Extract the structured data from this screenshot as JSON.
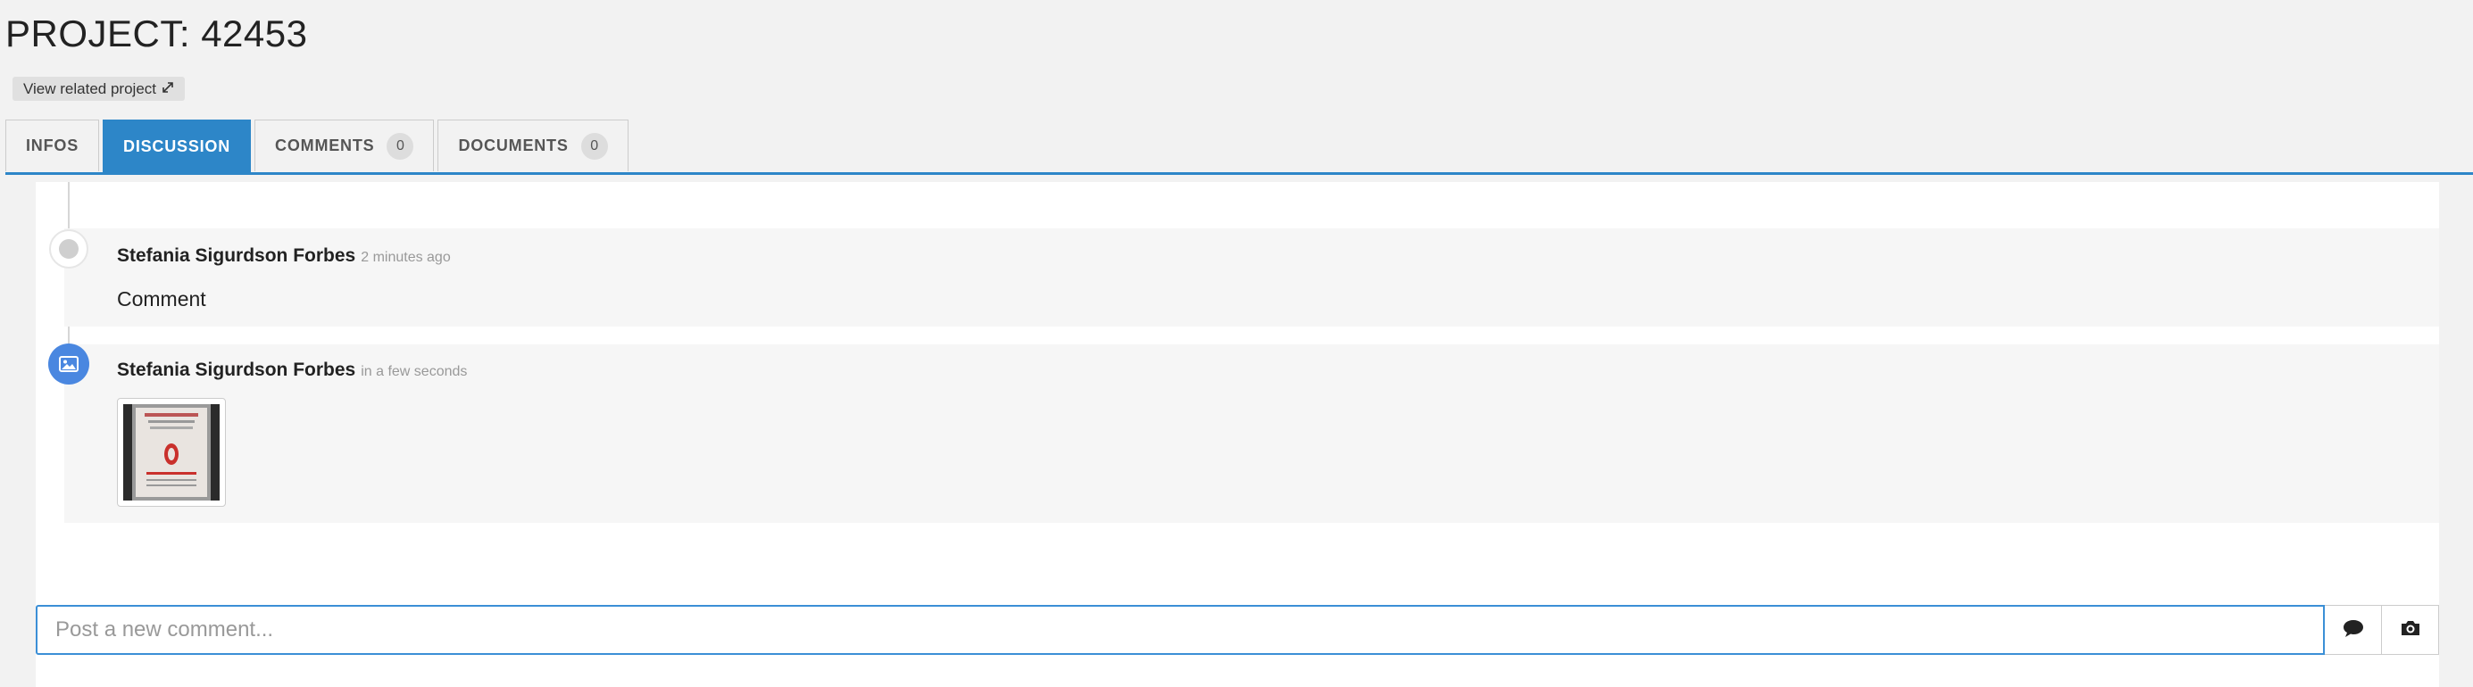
{
  "page": {
    "title": "PROJECT: 42453"
  },
  "related": {
    "label": "View related project"
  },
  "tabs": [
    {
      "label": "INFOS"
    },
    {
      "label": "DISCUSSION"
    },
    {
      "label": "COMMENTS",
      "count": "0"
    },
    {
      "label": "DOCUMENTS",
      "count": "0"
    }
  ],
  "discussion": {
    "entries": [
      {
        "author": "Stefania Sigurdson Forbes",
        "time": "2 minutes ago",
        "text": "Comment",
        "icon": "comment-dot-icon"
      },
      {
        "author": "Stefania Sigurdson Forbes",
        "time": "in a few seconds",
        "icon": "image-icon"
      }
    ]
  },
  "composer": {
    "placeholder": "Post a new comment...",
    "send_icon": "speech-bubble-icon",
    "photo_icon": "camera-icon"
  },
  "colors": {
    "accent": "#2d86c8",
    "image_badge": "#4a87e0"
  }
}
